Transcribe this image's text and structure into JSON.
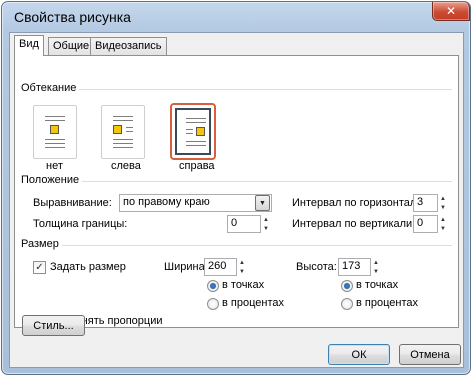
{
  "window": {
    "title": "Свойства рисунка",
    "close_glyph": "✕"
  },
  "tabs": [
    {
      "label": "Вид",
      "active": true
    },
    {
      "label": "Общие",
      "active": false
    },
    {
      "label": "Видеозапись",
      "active": false
    }
  ],
  "wrapping": {
    "group_label": "Обтекание",
    "options": [
      {
        "label": "нет",
        "icon": "wrap-none-icon",
        "selected": false
      },
      {
        "label": "слева",
        "icon": "wrap-left-icon",
        "selected": false
      },
      {
        "label": "справа",
        "icon": "wrap-right-icon",
        "selected": true
      }
    ]
  },
  "position": {
    "group_label": "Положение",
    "alignment_label": "Выравнивание:",
    "alignment_value": "по правому краю",
    "border_width_label": "Толщина границы:",
    "border_width_value": "0",
    "hspace_label": "Интервал по горизонтали:",
    "hspace_value": "3",
    "vspace_label": "Интервал по вертикали:",
    "vspace_value": "0"
  },
  "size": {
    "group_label": "Размер",
    "set_size_label": "Задать размер",
    "set_size_checked": true,
    "width_label": "Ширина:",
    "width_value": "260",
    "height_label": "Высота:",
    "height_value": "173",
    "unit_points": "в точках",
    "unit_percent": "в процентах",
    "width_unit_selected": "в точках",
    "height_unit_selected": "в точках",
    "keep_ratio_label": "Сохранять пропорции",
    "keep_ratio_checked": true,
    "style_button": "Стиль..."
  },
  "footer": {
    "ok": "ОК",
    "cancel": "Отмена"
  },
  "colors": {
    "selection_border": "#d4603c",
    "accent": "#3c7fb1",
    "close": "#cc4b33"
  }
}
